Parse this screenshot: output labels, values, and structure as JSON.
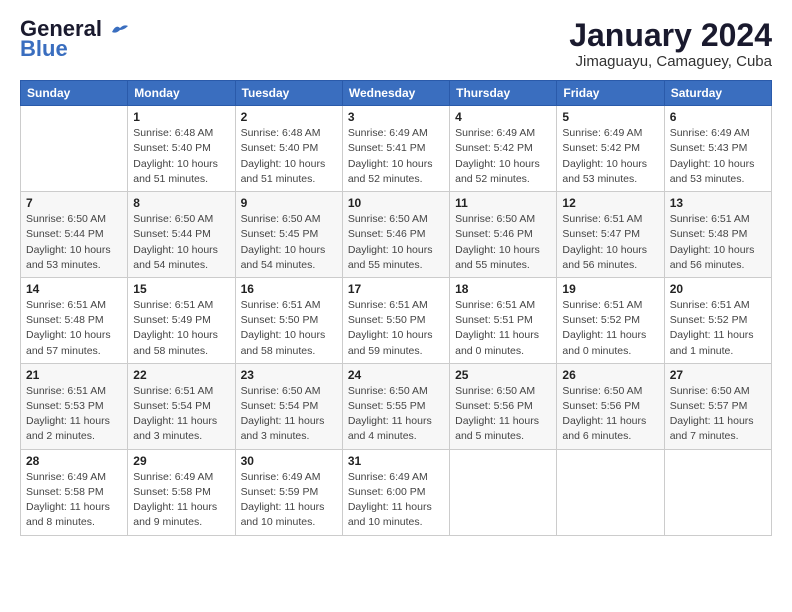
{
  "header": {
    "logo_line1": "General",
    "logo_line2": "Blue",
    "title": "January 2024",
    "subtitle": "Jimaguayu, Camaguey, Cuba"
  },
  "weekdays": [
    "Sunday",
    "Monday",
    "Tuesday",
    "Wednesday",
    "Thursday",
    "Friday",
    "Saturday"
  ],
  "weeks": [
    [
      {
        "day": "",
        "content": ""
      },
      {
        "day": "1",
        "content": "Sunrise: 6:48 AM\nSunset: 5:40 PM\nDaylight: 10 hours\nand 51 minutes."
      },
      {
        "day": "2",
        "content": "Sunrise: 6:48 AM\nSunset: 5:40 PM\nDaylight: 10 hours\nand 51 minutes."
      },
      {
        "day": "3",
        "content": "Sunrise: 6:49 AM\nSunset: 5:41 PM\nDaylight: 10 hours\nand 52 minutes."
      },
      {
        "day": "4",
        "content": "Sunrise: 6:49 AM\nSunset: 5:42 PM\nDaylight: 10 hours\nand 52 minutes."
      },
      {
        "day": "5",
        "content": "Sunrise: 6:49 AM\nSunset: 5:42 PM\nDaylight: 10 hours\nand 53 minutes."
      },
      {
        "day": "6",
        "content": "Sunrise: 6:49 AM\nSunset: 5:43 PM\nDaylight: 10 hours\nand 53 minutes."
      }
    ],
    [
      {
        "day": "7",
        "content": "Sunrise: 6:50 AM\nSunset: 5:44 PM\nDaylight: 10 hours\nand 53 minutes."
      },
      {
        "day": "8",
        "content": "Sunrise: 6:50 AM\nSunset: 5:44 PM\nDaylight: 10 hours\nand 54 minutes."
      },
      {
        "day": "9",
        "content": "Sunrise: 6:50 AM\nSunset: 5:45 PM\nDaylight: 10 hours\nand 54 minutes."
      },
      {
        "day": "10",
        "content": "Sunrise: 6:50 AM\nSunset: 5:46 PM\nDaylight: 10 hours\nand 55 minutes."
      },
      {
        "day": "11",
        "content": "Sunrise: 6:50 AM\nSunset: 5:46 PM\nDaylight: 10 hours\nand 55 minutes."
      },
      {
        "day": "12",
        "content": "Sunrise: 6:51 AM\nSunset: 5:47 PM\nDaylight: 10 hours\nand 56 minutes."
      },
      {
        "day": "13",
        "content": "Sunrise: 6:51 AM\nSunset: 5:48 PM\nDaylight: 10 hours\nand 56 minutes."
      }
    ],
    [
      {
        "day": "14",
        "content": "Sunrise: 6:51 AM\nSunset: 5:48 PM\nDaylight: 10 hours\nand 57 minutes."
      },
      {
        "day": "15",
        "content": "Sunrise: 6:51 AM\nSunset: 5:49 PM\nDaylight: 10 hours\nand 58 minutes."
      },
      {
        "day": "16",
        "content": "Sunrise: 6:51 AM\nSunset: 5:50 PM\nDaylight: 10 hours\nand 58 minutes."
      },
      {
        "day": "17",
        "content": "Sunrise: 6:51 AM\nSunset: 5:50 PM\nDaylight: 10 hours\nand 59 minutes."
      },
      {
        "day": "18",
        "content": "Sunrise: 6:51 AM\nSunset: 5:51 PM\nDaylight: 11 hours\nand 0 minutes."
      },
      {
        "day": "19",
        "content": "Sunrise: 6:51 AM\nSunset: 5:52 PM\nDaylight: 11 hours\nand 0 minutes."
      },
      {
        "day": "20",
        "content": "Sunrise: 6:51 AM\nSunset: 5:52 PM\nDaylight: 11 hours\nand 1 minute."
      }
    ],
    [
      {
        "day": "21",
        "content": "Sunrise: 6:51 AM\nSunset: 5:53 PM\nDaylight: 11 hours\nand 2 minutes."
      },
      {
        "day": "22",
        "content": "Sunrise: 6:51 AM\nSunset: 5:54 PM\nDaylight: 11 hours\nand 3 minutes."
      },
      {
        "day": "23",
        "content": "Sunrise: 6:50 AM\nSunset: 5:54 PM\nDaylight: 11 hours\nand 3 minutes."
      },
      {
        "day": "24",
        "content": "Sunrise: 6:50 AM\nSunset: 5:55 PM\nDaylight: 11 hours\nand 4 minutes."
      },
      {
        "day": "25",
        "content": "Sunrise: 6:50 AM\nSunset: 5:56 PM\nDaylight: 11 hours\nand 5 minutes."
      },
      {
        "day": "26",
        "content": "Sunrise: 6:50 AM\nSunset: 5:56 PM\nDaylight: 11 hours\nand 6 minutes."
      },
      {
        "day": "27",
        "content": "Sunrise: 6:50 AM\nSunset: 5:57 PM\nDaylight: 11 hours\nand 7 minutes."
      }
    ],
    [
      {
        "day": "28",
        "content": "Sunrise: 6:49 AM\nSunset: 5:58 PM\nDaylight: 11 hours\nand 8 minutes."
      },
      {
        "day": "29",
        "content": "Sunrise: 6:49 AM\nSunset: 5:58 PM\nDaylight: 11 hours\nand 9 minutes."
      },
      {
        "day": "30",
        "content": "Sunrise: 6:49 AM\nSunset: 5:59 PM\nDaylight: 11 hours\nand 10 minutes."
      },
      {
        "day": "31",
        "content": "Sunrise: 6:49 AM\nSunset: 6:00 PM\nDaylight: 11 hours\nand 10 minutes."
      },
      {
        "day": "",
        "content": ""
      },
      {
        "day": "",
        "content": ""
      },
      {
        "day": "",
        "content": ""
      }
    ]
  ]
}
